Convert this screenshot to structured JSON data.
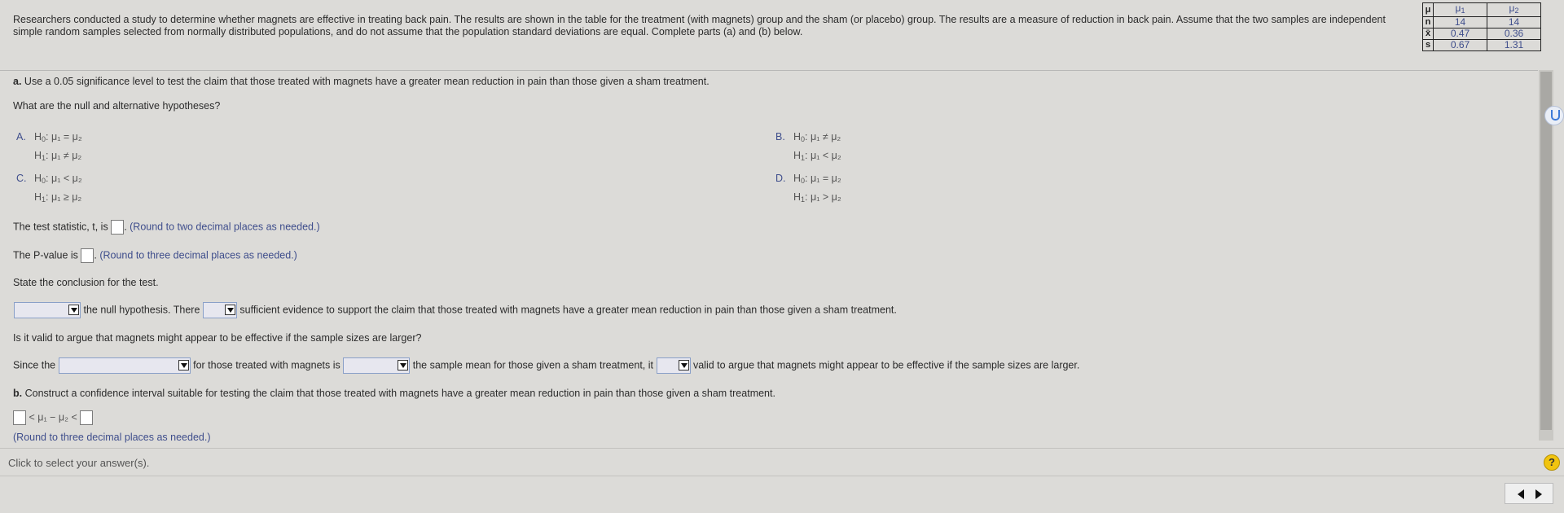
{
  "intro": "Researchers conducted a study to determine whether magnets are effective in treating back pain. The results are shown in the table for the treatment (with magnets) group and the sham (or placebo) group. The results are a measure of reduction in back pain. Assume that the two samples are independent simple random samples selected from normally distributed populations, and do not assume that the population standard deviations are equal. Complete parts (a) and (b) below.",
  "table": {
    "header": {
      "label": "μ",
      "c1": "μ",
      "c1sub": "1",
      "c2": "μ",
      "c2sub": "2"
    },
    "rows": [
      {
        "label": "n",
        "v1": "14",
        "v2": "14"
      },
      {
        "label": "x̄",
        "v1": "0.47",
        "v2": "0.36"
      },
      {
        "label": "s",
        "v1": "0.67",
        "v2": "1.31"
      }
    ]
  },
  "part_a": {
    "prompt_prefix": "a.",
    "prompt": "Use a 0.05 significance level to test the claim that those treated with magnets have a greater mean reduction in pain than those given a sham treatment.",
    "hyp_question": "What are the null and alternative hypotheses?",
    "options": [
      {
        "letter": "A.",
        "h0": "μ₁ = μ₂",
        "h1": "μ₁ ≠ μ₂"
      },
      {
        "letter": "B.",
        "h0": "μ₁ ≠ μ₂",
        "h1": "μ₁ < μ₂"
      },
      {
        "letter": "C.",
        "h0": "μ₁ < μ₂",
        "h1": "μ₁ ≥ μ₂"
      },
      {
        "letter": "D.",
        "h0": "μ₁ = μ₂",
        "h1": "μ₁ > μ₂"
      }
    ],
    "h0_label": "H",
    "h0_sub": "0",
    "h1_label": "H",
    "h1_sub": "1",
    "test_stat_label": "The test statistic, t, is",
    "test_stat_hint": "(Round to two decimal places as needed.)",
    "pvalue_label": "The P-value is",
    "pvalue_hint": "(Round to three decimal places as needed.)",
    "conclusion_label": "State the conclusion for the test.",
    "conclusion_mid": "the null hypothesis. There",
    "conclusion_end": "sufficient evidence to support the claim that those treated with magnets have a greater mean reduction in pain than those given a sham treatment.",
    "valid_question": "Is it valid to argue that magnets might appear to be effective if the sample sizes are larger?",
    "since_a": "Since the",
    "since_b": "for those treated with magnets is",
    "since_c": "the sample mean for those given a sham treatment, it",
    "since_d": "valid to argue that magnets might appear to be effective if the sample sizes are larger."
  },
  "part_b": {
    "prompt_prefix": "b.",
    "prompt": "Construct a confidence interval suitable for testing the claim that those treated with magnets have a greater mean reduction in pain than those given a sham treatment.",
    "interval_mid": "< μ₁ − μ₂ <",
    "hint": "(Round to three decimal places as needed.)"
  },
  "footer": {
    "status": "Click to select your answer(s).",
    "help": "?"
  }
}
